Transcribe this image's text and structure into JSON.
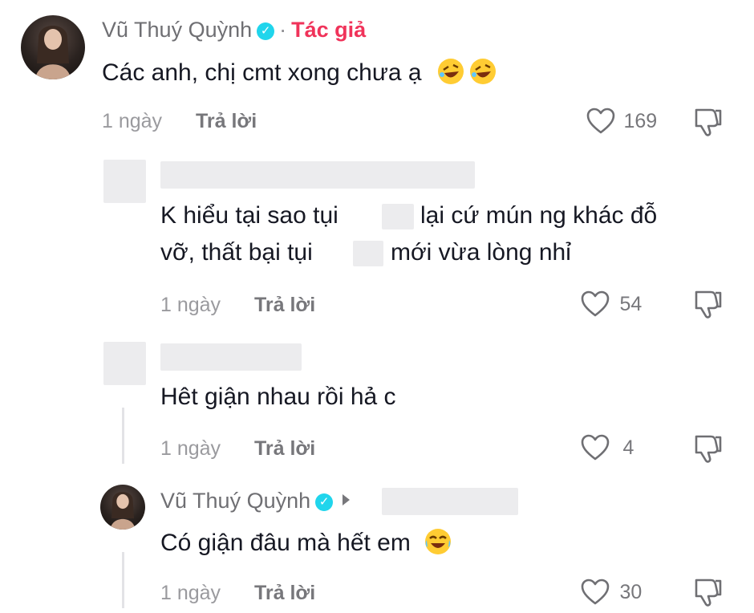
{
  "comments": [
    {
      "author": "Vũ Thuý Quỳnh",
      "author_tag": "Tác giả",
      "text": "Các anh, chị cmt xong chưa ạ",
      "emoji": "rolling-laughing-emoji x2",
      "time": "1 ngày",
      "reply_label": "Trả lời",
      "likes": "169"
    }
  ],
  "replies": [
    {
      "author": "",
      "text_line1_a": "K hiểu tại sao tụi",
      "text_line1_b": "lại cứ mún ng khác đỗ",
      "text_line2_a": "vỡ, thất bại tụi",
      "text_line2_b": "mới vừa lòng nhỉ",
      "time": "1 ngày",
      "reply_label": "Trả lời",
      "likes": "54"
    },
    {
      "author": "",
      "text": "Hêt giận nhau rồi hả c",
      "time": "1 ngày",
      "reply_label": "Trả lời",
      "likes": "4"
    },
    {
      "author": "Vũ Thuý Quỳnh",
      "text": "Có giận đâu mà hết em",
      "emoji": "tears-of-joy-emoji",
      "time": "1 ngày",
      "reply_label": "Trả lời",
      "likes": "30"
    }
  ],
  "colors": {
    "verified": "#20d5ec",
    "author_tag": "#f0335a",
    "text": "#161823",
    "muted": "#77777b"
  }
}
